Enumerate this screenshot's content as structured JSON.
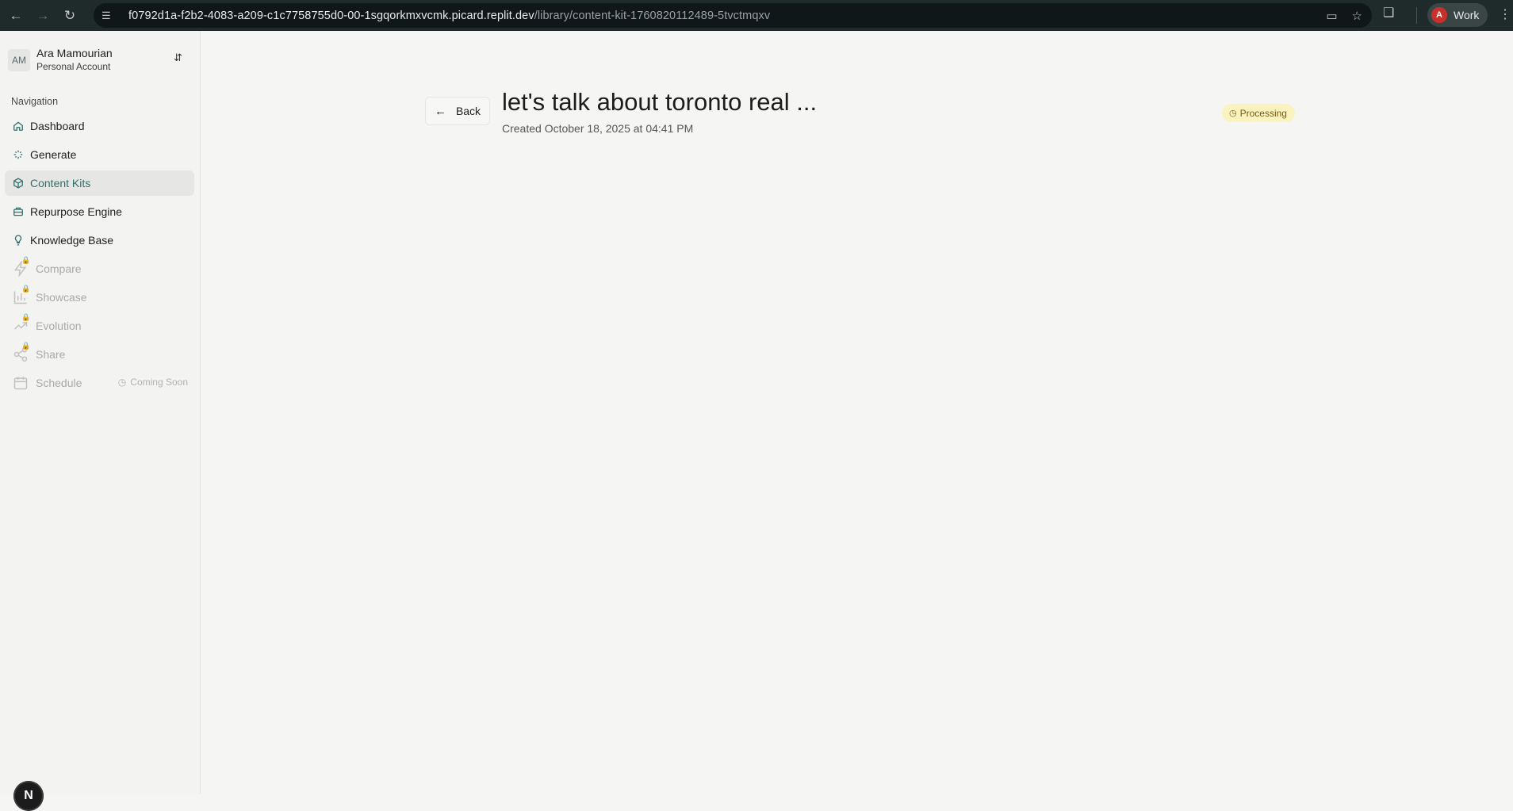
{
  "browser": {
    "url_host": "f0792d1a-f2b2-4083-a209-c1c7758755d0-00-1sgqorkmxvcmk.picard.replit.dev",
    "url_path": "/library/content-kit-1760820112489-5tvctmqxv",
    "profile_initial": "A",
    "profile_label": "Work"
  },
  "account": {
    "initials": "AM",
    "name": "Ara Mamourian",
    "type": "Personal Account"
  },
  "sidebar": {
    "heading": "Navigation",
    "items": [
      {
        "label": "Dashboard",
        "icon": "home-icon"
      },
      {
        "label": "Generate",
        "icon": "sparkles-icon"
      },
      {
        "label": "Content Kits",
        "icon": "box-icon"
      },
      {
        "label": "Repurpose Engine",
        "icon": "briefcase-icon"
      },
      {
        "label": "Knowledge Base",
        "icon": "lightbulb-icon"
      },
      {
        "label": "Compare",
        "icon": "zap-icon"
      },
      {
        "label": "Showcase",
        "icon": "bar-chart-icon"
      },
      {
        "label": "Evolution",
        "icon": "trending-up-icon"
      },
      {
        "label": "Share",
        "icon": "share-icon"
      },
      {
        "label": "Schedule",
        "icon": "calendar-icon",
        "badge": "Coming Soon"
      }
    ]
  },
  "main": {
    "back_label": "Back",
    "title": "let's talk about toronto real ...",
    "created": "Created October 18, 2025 at 04:41 PM",
    "status": "Processing"
  },
  "footer": {
    "badge": "N"
  },
  "colors": {
    "accent": "#2f6f6a",
    "status_bg": "#fbf3bf",
    "status_text": "#7a5a10"
  }
}
